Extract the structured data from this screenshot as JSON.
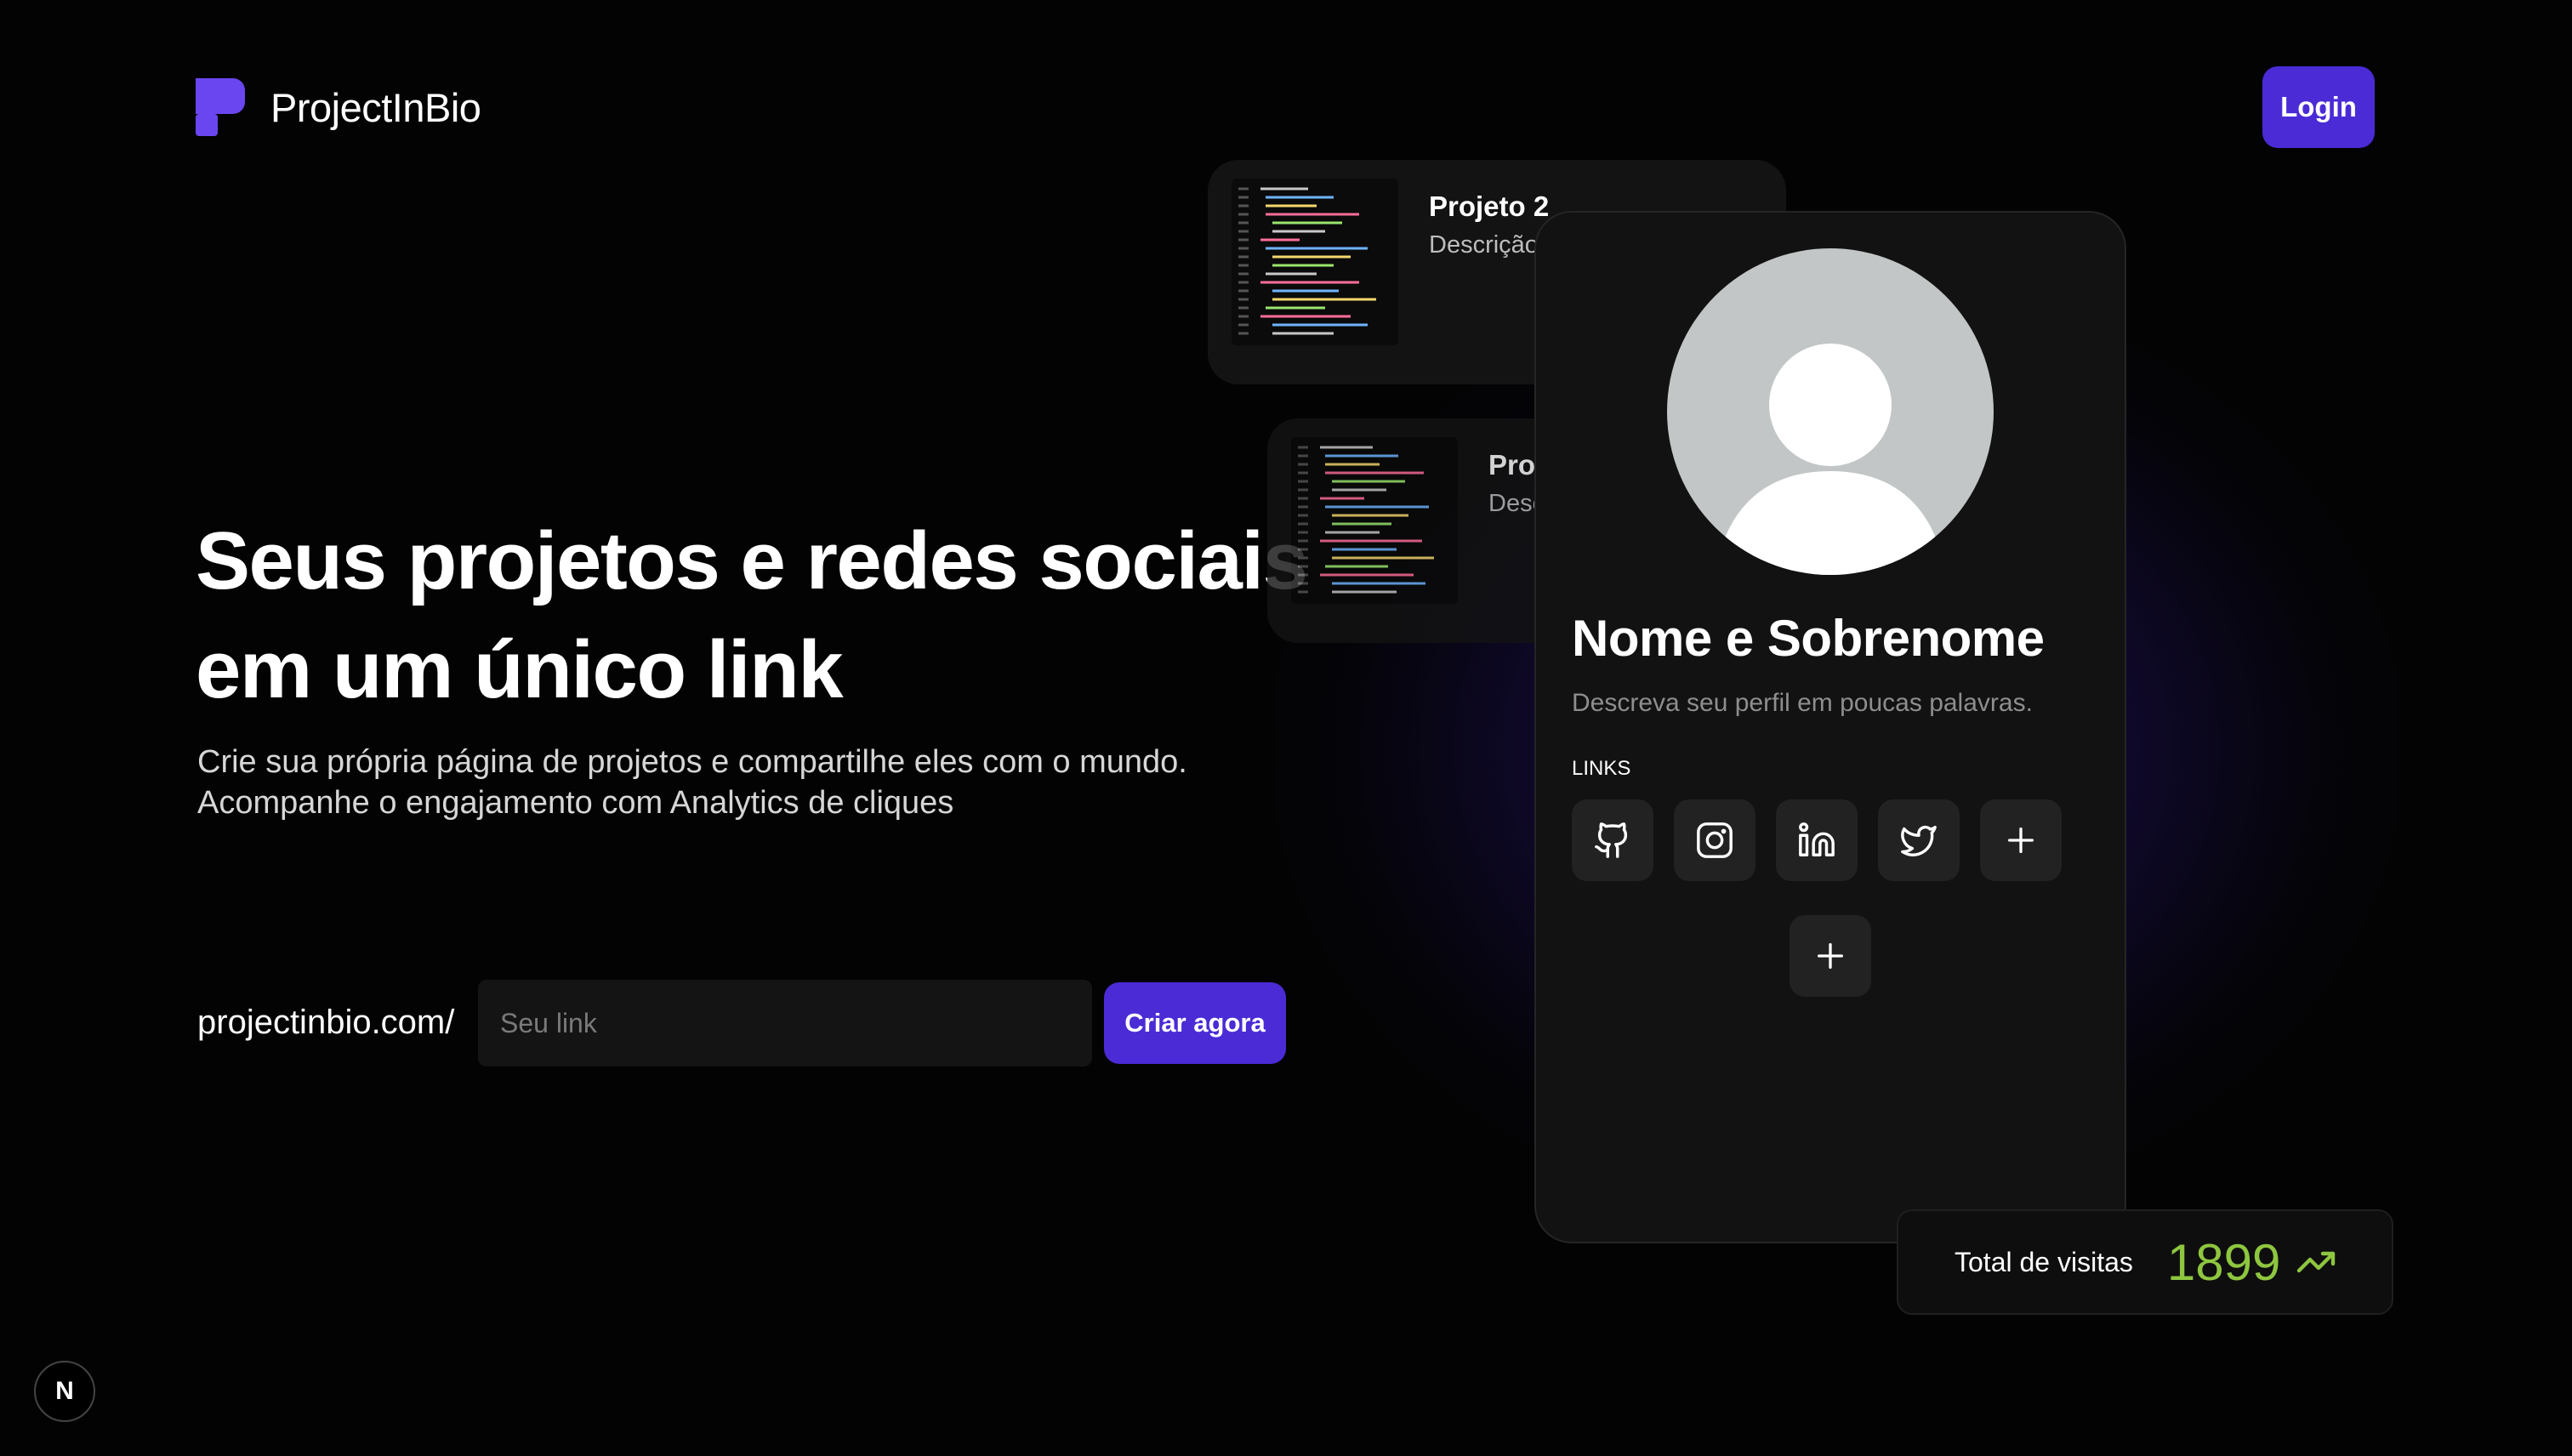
{
  "header": {
    "brand": "ProjectInBio",
    "login_label": "Login"
  },
  "hero": {
    "title_line1": "Seus projetos e redes sociais",
    "title_line2": "em um único link",
    "subtitle_line1": "Crie sua própria página de projetos e compartilhe eles com o mundo.",
    "subtitle_line2": "Acompanhe o engajamento com Analytics de cliques",
    "link_prefix": "projectinbio.com/",
    "link_placeholder": "Seu link",
    "create_label": "Criar agora"
  },
  "projects": [
    {
      "title": "Projeto 2",
      "desc": "Descrição"
    },
    {
      "title": "Proj",
      "desc": "Desc"
    }
  ],
  "profile": {
    "name": "Nome e Sobrenome",
    "desc": "Descreva seu perfil em poucas palavras.",
    "links_label": "LINKS",
    "link_icons": [
      "github-icon",
      "instagram-icon",
      "linkedin-icon",
      "twitter-icon",
      "plus-icon"
    ]
  },
  "visits": {
    "label": "Total de visitas",
    "value": "1899"
  },
  "badge": {
    "label": "N"
  },
  "colors": {
    "accent": "#4b2bd6",
    "visits": "#8ec63f",
    "card": "#121212"
  }
}
